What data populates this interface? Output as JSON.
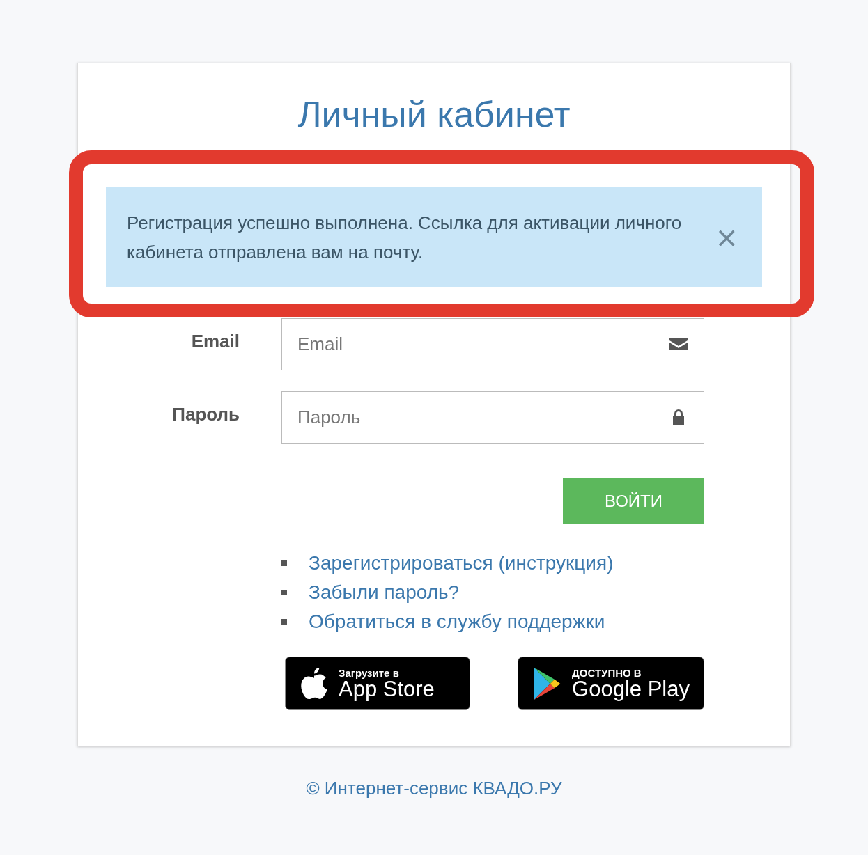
{
  "title": "Личный кабинет",
  "alert": {
    "text": "Регистрация успешно выполнена. Ссылка для активации личного кабинета отправлена вам на почту.",
    "close": "×"
  },
  "fields": [
    {
      "kind": "email",
      "label": "Email",
      "placeholder": "Email"
    },
    {
      "kind": "password",
      "label": "Пароль",
      "placeholder": "Пароль"
    }
  ],
  "submit": "ВОЙТИ",
  "links": [
    "Зарегистрироваться (инструкция)",
    "Забыли пароль?",
    "Обратиться в службу поддержки"
  ],
  "badges": [
    {
      "kind": "apple",
      "small": "Загрузите в",
      "big": "App Store"
    },
    {
      "kind": "google",
      "small": "ДОСТУПНО В",
      "big": "Google Play"
    }
  ],
  "footer": "© Интернет-сервис КВАДО.РУ"
}
